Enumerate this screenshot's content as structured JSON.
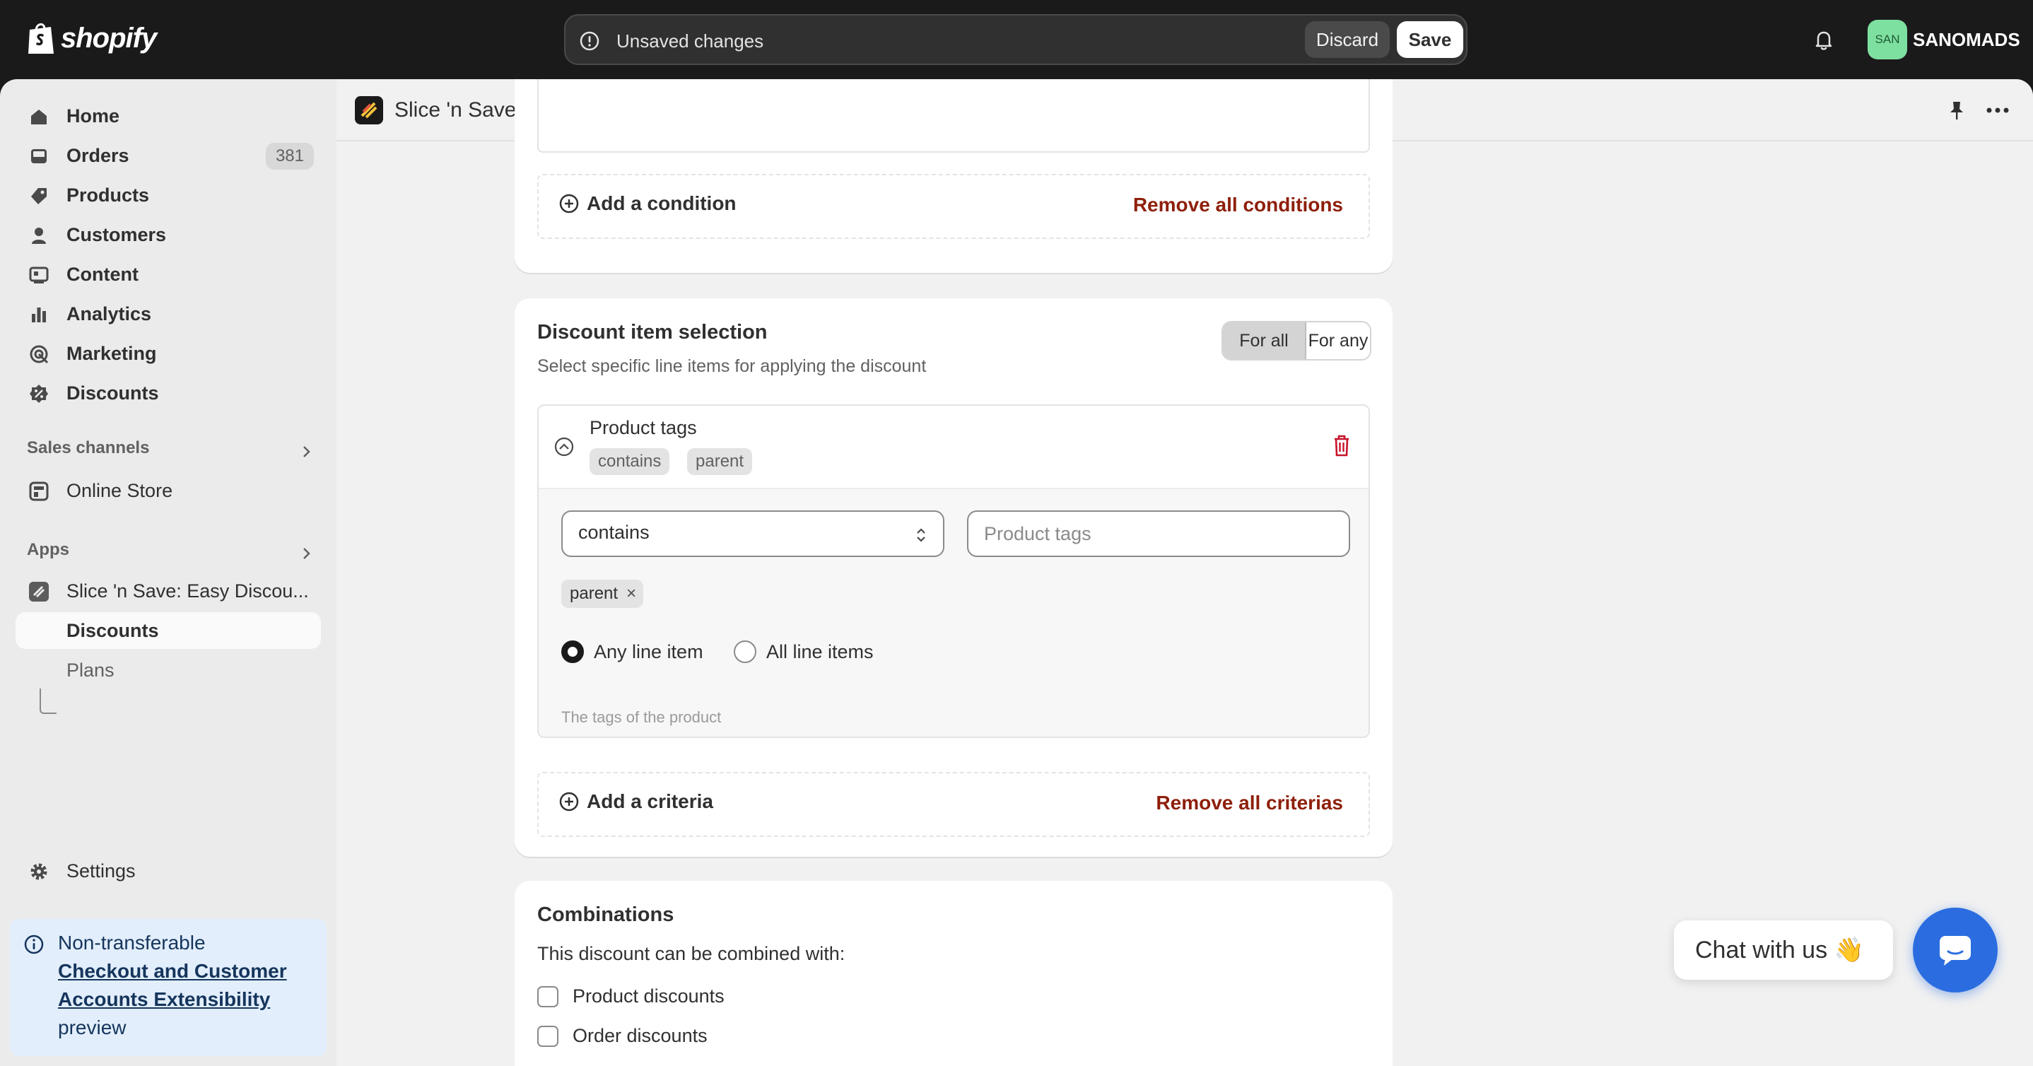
{
  "brand": {
    "name": "shopify"
  },
  "topbar": {
    "unsaved_text": "Unsaved changes",
    "discard_label": "Discard",
    "save_label": "Save",
    "avatar_initials": "SAN",
    "store_name": "SANOMADS"
  },
  "sidebar": {
    "items": [
      {
        "label": "Home",
        "icon": "home-icon"
      },
      {
        "label": "Orders",
        "icon": "orders-icon",
        "badge": "381"
      },
      {
        "label": "Products",
        "icon": "tag-icon"
      },
      {
        "label": "Customers",
        "icon": "person-icon"
      },
      {
        "label": "Content",
        "icon": "content-icon"
      },
      {
        "label": "Analytics",
        "icon": "bar-chart-icon"
      },
      {
        "label": "Marketing",
        "icon": "target-icon"
      },
      {
        "label": "Discounts",
        "icon": "discount-icon"
      }
    ],
    "sales_channels_label": "Sales channels",
    "online_store_label": "Online Store",
    "apps_label": "Apps",
    "app_name": "Slice 'n Save: Easy Discou...",
    "app_sub_discounts": "Discounts",
    "app_sub_plans": "Plans",
    "settings_label": "Settings",
    "banner": {
      "prefix": "Non-transferable",
      "link": "Checkout and Customer Accounts Extensibility",
      "suffix": "preview"
    }
  },
  "appbar": {
    "title": "Slice 'n Save: Easy Discounts"
  },
  "conditions": {
    "add_label": "Add a condition",
    "remove_label": "Remove all conditions"
  },
  "discount_selection": {
    "title": "Discount item selection",
    "subtitle": "Select specific line items for applying the discount",
    "toggle_all": "For all",
    "toggle_any": "For any",
    "criteria": {
      "name": "Product tags",
      "pill_operator": "contains",
      "pill_value": "parent",
      "select_value": "contains",
      "input_placeholder": "Product tags",
      "tag": "parent",
      "tag_remove": "×",
      "radio_any": "Any line item",
      "radio_all": "All line items",
      "help": "The tags of the product"
    },
    "add_label": "Add a criteria",
    "remove_label": "Remove all criterias"
  },
  "combinations": {
    "title": "Combinations",
    "subtitle": "This discount can be combined with:",
    "options": [
      "Product discounts",
      "Order discounts"
    ]
  },
  "chat": {
    "label": "Chat with us 👋"
  }
}
